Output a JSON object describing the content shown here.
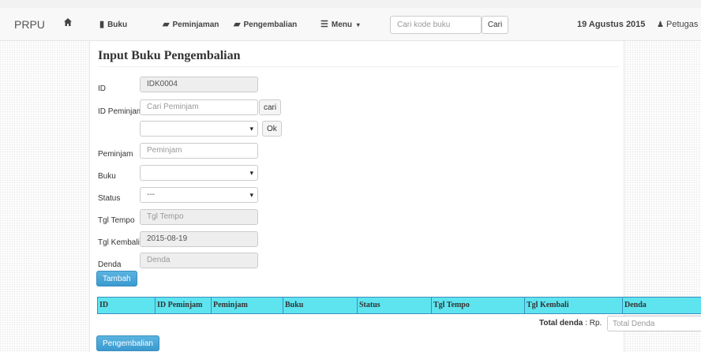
{
  "navbar": {
    "brand": "PRPU",
    "items": [
      {
        "label": "Buku"
      },
      {
        "label": "Peminjaman"
      },
      {
        "label": "Pengembalian"
      },
      {
        "label": "Menu"
      }
    ],
    "search_placeholder": "Cari kode buku",
    "search_button": "Cari",
    "date": "19 Agustus 2015",
    "user": "Petugas"
  },
  "form": {
    "title": "Input Buku Pengembalian",
    "id": {
      "label": "ID",
      "value": "IDK0004"
    },
    "id_peminjam": {
      "label": "ID Peminjam",
      "placeholder": "Cari Peminjam",
      "button": "cari"
    },
    "select_peminjam": {
      "value": "",
      "button": "Ok"
    },
    "peminjam": {
      "label": "Peminjam",
      "placeholder": "Peminjam"
    },
    "buku": {
      "label": "Buku",
      "value": ""
    },
    "status": {
      "label": "Status",
      "value": "---"
    },
    "tgl_tempo": {
      "label": "Tgl Tempo",
      "placeholder": "Tgl Tempo"
    },
    "tgl_kembali": {
      "label": "Tgl Kembali",
      "value": "2015-08-19"
    },
    "denda": {
      "label": "Denda",
      "placeholder": "Denda"
    },
    "add_button": "Tambah"
  },
  "table": {
    "columns": [
      "ID",
      "ID Peminjam",
      "Peminjam",
      "Buku",
      "Status",
      "Tgl Tempo",
      "Tgl Kembali",
      "Denda"
    ],
    "rows": []
  },
  "total": {
    "label": "Total denda",
    "currency": "Rp.",
    "placeholder": "Total Denda"
  },
  "submit_button": "Pengembalian",
  "colors": {
    "header_bg": "#5ee4ef",
    "header_border": "#3a8fbf",
    "primary_button": "#3a9ad0"
  },
  "icons": [
    "home-icon",
    "book-icon",
    "folder-open-icon",
    "list-icon",
    "caret-down-icon",
    "user-icon"
  ]
}
